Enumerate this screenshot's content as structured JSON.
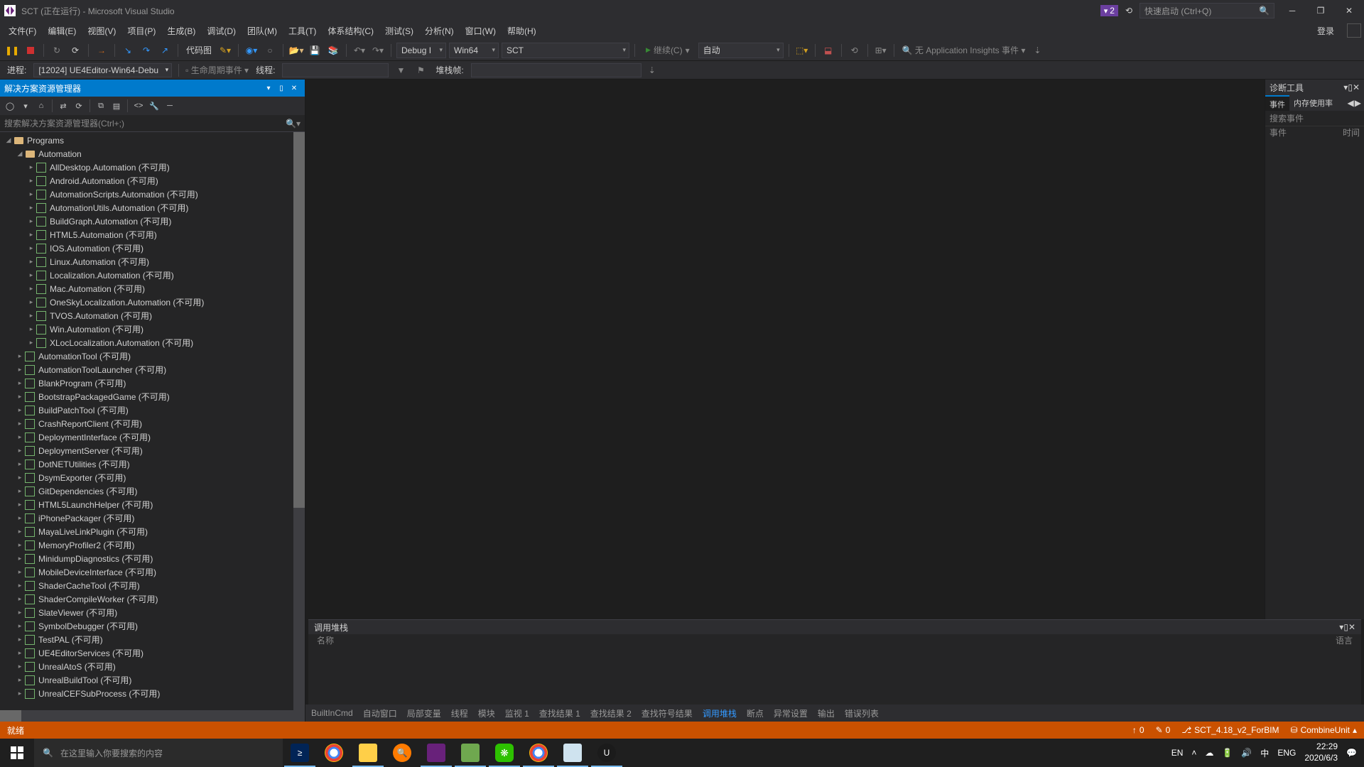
{
  "title": "SCT (正在运行) - Microsoft Visual Studio",
  "notif_count": "2",
  "quick_launch": "快速启动 (Ctrl+Q)",
  "menu": [
    "文件(F)",
    "编辑(E)",
    "视图(V)",
    "项目(P)",
    "生成(B)",
    "调试(D)",
    "团队(M)",
    "工具(T)",
    "体系结构(C)",
    "测试(S)",
    "分析(N)",
    "窗口(W)",
    "帮助(H)"
  ],
  "signin": "登录",
  "toolbar": {
    "code_view": "代码图",
    "debug": "Debug I",
    "platform": "Win64",
    "target": "SCT",
    "continue": "继续(C)",
    "auto": "自动",
    "insights": "无 Application Insights 事件"
  },
  "toolbar2": {
    "process_label": "进程:",
    "process": "[12024] UE4Editor-Win64-Debu",
    "lifecycle": "生命周期事件",
    "thread_label": "线程:",
    "stackframe": "堆栈帧:"
  },
  "solution": {
    "title": "解决方案资源管理器",
    "search": "搜索解决方案资源管理器(Ctrl+;)",
    "root": "Programs",
    "automation": "Automation",
    "auto_children": [
      "AllDesktop.Automation (不可用)",
      "Android.Automation (不可用)",
      "AutomationScripts.Automation (不可用)",
      "AutomationUtils.Automation (不可用)",
      "BuildGraph.Automation (不可用)",
      "HTML5.Automation (不可用)",
      "IOS.Automation (不可用)",
      "Linux.Automation (不可用)",
      "Localization.Automation (不可用)",
      "Mac.Automation (不可用)",
      "OneSkyLocalization.Automation (不可用)",
      "TVOS.Automation (不可用)",
      "Win.Automation (不可用)",
      "XLocLocalization.Automation (不可用)"
    ],
    "siblings": [
      "AutomationTool (不可用)",
      "AutomationToolLauncher (不可用)",
      "BlankProgram (不可用)",
      "BootstrapPackagedGame (不可用)",
      "BuildPatchTool (不可用)",
      "CrashReportClient (不可用)",
      "DeploymentInterface (不可用)",
      "DeploymentServer (不可用)",
      "DotNETUtilities (不可用)",
      "DsymExporter (不可用)",
      "GitDependencies (不可用)",
      "HTML5LaunchHelper (不可用)",
      "iPhonePackager (不可用)",
      "MayaLiveLinkPlugin (不可用)",
      "MemoryProfiler2 (不可用)",
      "MinidumpDiagnostics (不可用)",
      "MobileDeviceInterface (不可用)",
      "ShaderCacheTool (不可用)",
      "ShaderCompileWorker (不可用)",
      "SlateViewer (不可用)",
      "SymbolDebugger (不可用)",
      "TestPAL (不可用)",
      "UE4EditorServices (不可用)",
      "UnrealAtoS (不可用)",
      "UnrealBuildTool (不可用)",
      "UnrealCEFSubProcess (不可用)"
    ]
  },
  "diag": {
    "title": "诊断工具",
    "tab_events": "事件",
    "tab_memory": "内存使用率",
    "search_events": "搜索事件",
    "col_event": "事件",
    "col_time": "时间"
  },
  "callstack": {
    "title": "调用堆栈",
    "col_name": "名称",
    "col_lang": "语言"
  },
  "bottom_tabs": [
    "BuiltInCmd",
    "自动窗口",
    "局部变量",
    "线程",
    "模块",
    "监视 1",
    "查找结果 1",
    "查找结果 2",
    "查找符号结果",
    "调用堆栈",
    "断点",
    "异常设置",
    "输出",
    "错误列表"
  ],
  "bottom_active": 9,
  "status": {
    "ready": "就绪",
    "up": "0",
    "down": "0",
    "branch": "SCT_4.18_v2_ForBIM",
    "repo": "CombineUnit"
  },
  "taskbar": {
    "search": "在这里输入你要搜索的内容",
    "ime1": "EN",
    "ime2": "中",
    "lang": "ENG",
    "time": "22:29",
    "date": "2020/6/3"
  }
}
